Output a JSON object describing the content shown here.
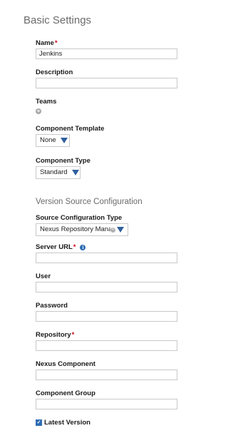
{
  "basic_settings": {
    "title": "Basic Settings",
    "name": {
      "label": "Name",
      "value": "Jenkins"
    },
    "description": {
      "label": "Description",
      "value": ""
    },
    "teams": {
      "label": "Teams"
    },
    "component_template": {
      "label": "Component Template",
      "selected": "None"
    },
    "component_type": {
      "label": "Component Type",
      "selected": "Standard"
    }
  },
  "version_source": {
    "title": "Version Source Configuration",
    "source_config_type": {
      "label": "Source Configuration Type",
      "selected": "Nexus Repository Manag"
    },
    "server_url": {
      "label": "Server URL",
      "value": ""
    },
    "user": {
      "label": "User",
      "value": ""
    },
    "password": {
      "label": "Password",
      "value": ""
    },
    "repository": {
      "label": "Repository",
      "value": ""
    },
    "nexus_component": {
      "label": "Nexus Component",
      "value": ""
    },
    "component_group": {
      "label": "Component Group",
      "value": ""
    },
    "latest_version": {
      "label": "Latest Version",
      "checked": true
    }
  },
  "required_marker": "*",
  "colors": {
    "accent": "#2f6cb3",
    "required": "#d0021b"
  }
}
